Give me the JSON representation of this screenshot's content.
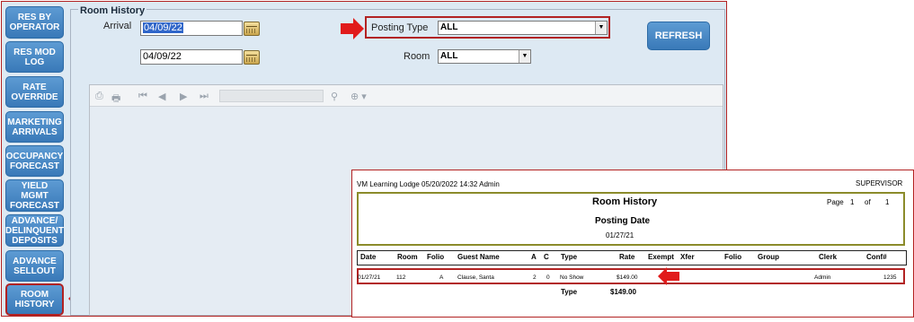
{
  "sidebar": {
    "items": [
      {
        "label": "RES BY\nOPERATOR"
      },
      {
        "label": "RES MOD\nLOG"
      },
      {
        "label": "RATE\nOVERRIDE"
      },
      {
        "label": "MARKETING\nARRIVALS"
      },
      {
        "label": "OCCUPANCY\nFORECAST"
      },
      {
        "label": "YIELD\nMGMT\nFORECAST"
      },
      {
        "label": "ADVANCE/\nDELINQUENT\nDEPOSITS"
      },
      {
        "label": "ADVANCE\nSELLOUT"
      },
      {
        "label": "ROOM\nHISTORY"
      }
    ]
  },
  "panel": {
    "title": "Room History",
    "arrival_label": "Arrival",
    "arrival_from": "04/09/22",
    "arrival_to": "04/09/22",
    "posting_type_label": "Posting Type",
    "posting_type_value": "ALL",
    "room_label": "Room",
    "room_value": "ALL",
    "refresh_label": "REFRESH"
  },
  "report": {
    "header_left": "VM Learning Lodge 05/20/2022 14:32  Admin",
    "header_right": "SUPERVISOR",
    "title": "Room History",
    "page_label": "Page",
    "page_num": "1",
    "of_label": "of",
    "page_total": "1",
    "subtitle": "Posting Date",
    "posting_date": "01/27/21",
    "columns": [
      "Date",
      "Room",
      "Folio",
      "Guest Name",
      "A",
      "C",
      "Type",
      "Rate",
      "Exempt",
      "Xfer",
      "Folio",
      "Group",
      "Clerk",
      "Conf#"
    ],
    "row": {
      "date": "01/27/21",
      "room": "112",
      "folio": "A",
      "guest": "Clause, Santa",
      "a": "2",
      "c": "0",
      "type": "No Show",
      "rate": "$149.00",
      "clerk": "Admin",
      "conf": "1235"
    },
    "total_label": "Type",
    "total_value": "$149.00"
  },
  "colors": {
    "button_blue": "#3979b8",
    "highlight_red": "#b22222",
    "panel_bg": "#dde9f3"
  }
}
